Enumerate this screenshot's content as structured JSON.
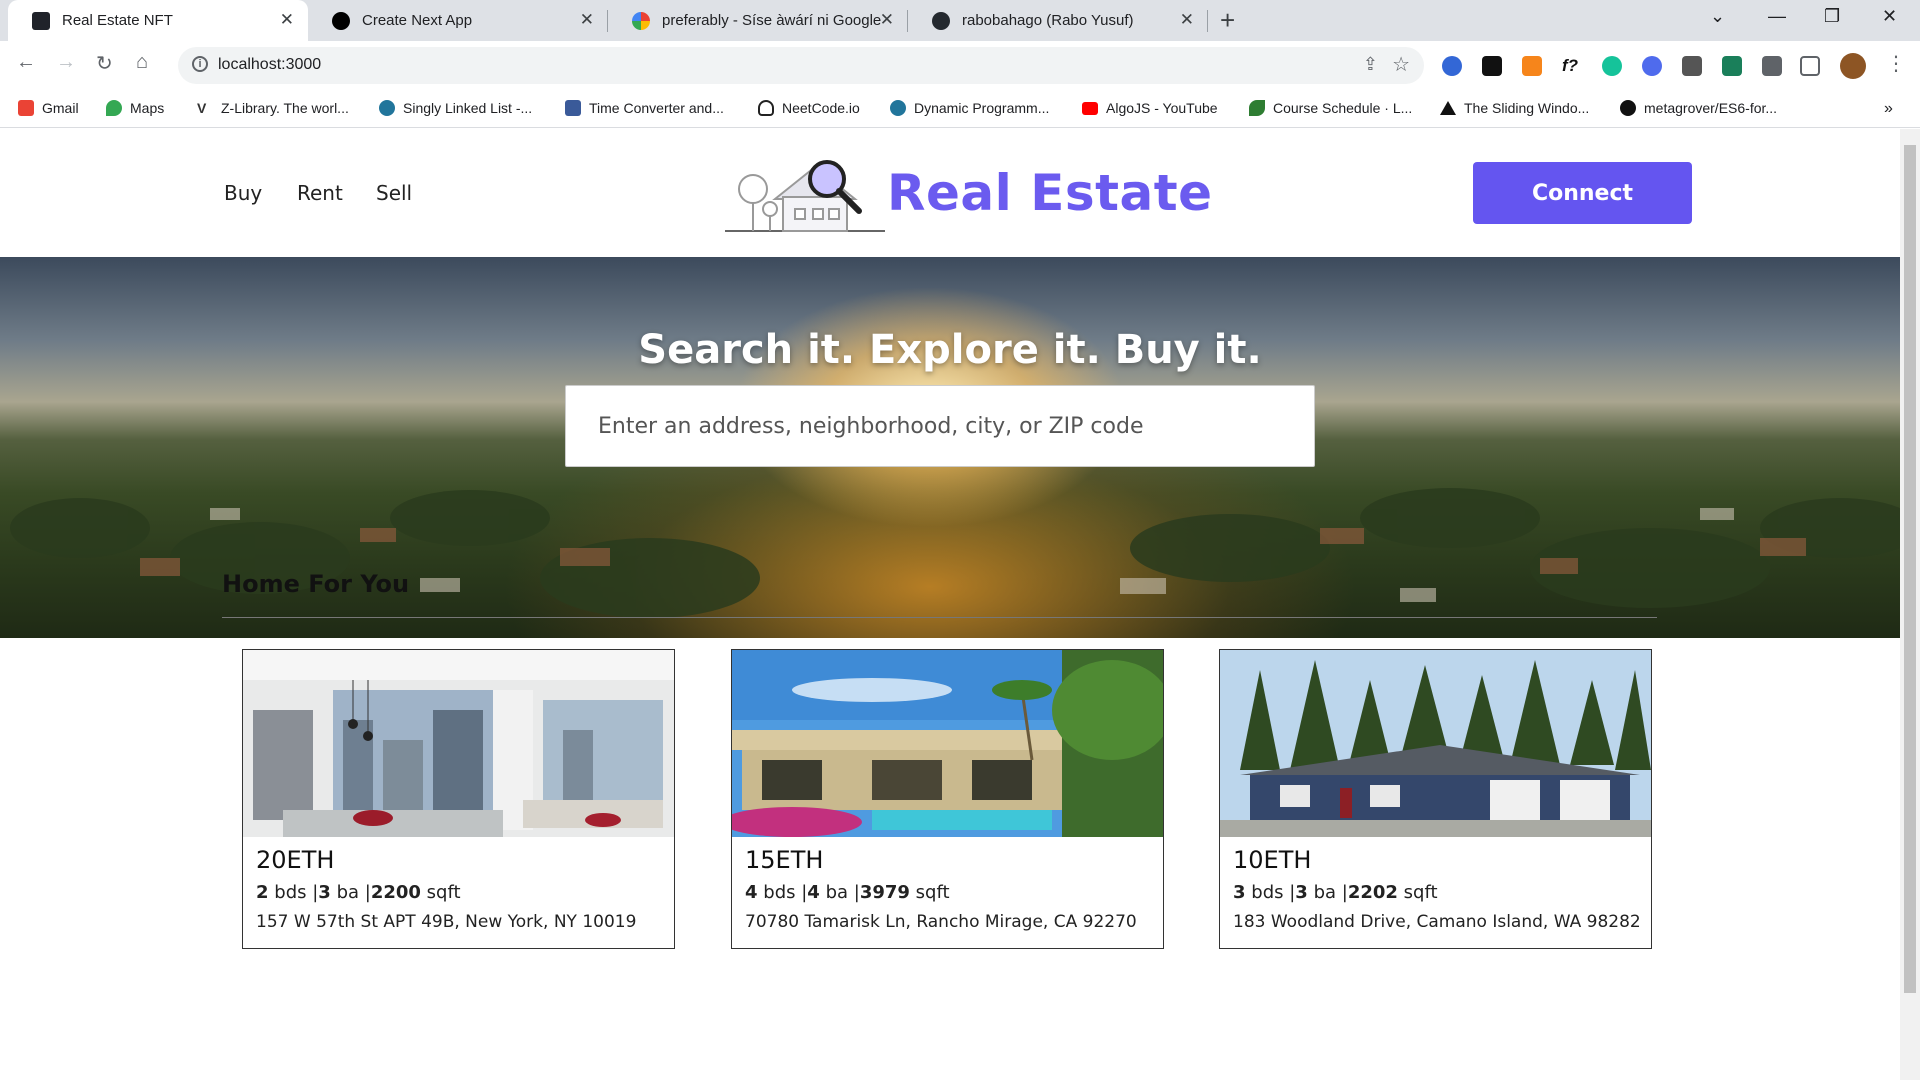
{
  "browser": {
    "tabs": [
      {
        "title": "Real Estate NFT",
        "icon": "react-icon",
        "active": true
      },
      {
        "title": "Create Next App",
        "icon": "nextjs-icon",
        "active": false
      },
      {
        "title": "preferably - Síse àwárí ni Google",
        "icon": "google-icon",
        "active": false
      },
      {
        "title": "rabobahago (Rabo Yusuf)",
        "icon": "github-icon",
        "active": false
      }
    ],
    "url": "localhost:3000",
    "bookmarks": [
      {
        "label": "Gmail",
        "icon": "gmail-icon",
        "color": "#ea4335"
      },
      {
        "label": "Maps",
        "icon": "maps-icon",
        "color": "#34a853"
      },
      {
        "label": "Z-Library. The worl...",
        "icon": "zlibrary-icon",
        "color": "#333333"
      },
      {
        "label": "Singly Linked List -...",
        "icon": "wordpress-icon",
        "color": "#21759b"
      },
      {
        "label": "Time Converter and...",
        "icon": "time-converter-icon",
        "color": "#3a5a99"
      },
      {
        "label": "NeetCode.io",
        "icon": "neetcode-icon",
        "color": "#222222"
      },
      {
        "label": "Dynamic Programm...",
        "icon": "wordpress-icon",
        "color": "#21759b"
      },
      {
        "label": "AlgoJS - YouTube",
        "icon": "youtube-icon",
        "color": "#ff0000"
      },
      {
        "label": "Course Schedule · L...",
        "icon": "leaf-icon",
        "color": "#2e7d32"
      },
      {
        "label": "The Sliding Windo...",
        "icon": "triangle-icon",
        "color": "#111111"
      },
      {
        "label": "metagrover/ES6-for...",
        "icon": "github-icon",
        "color": "#111111"
      }
    ]
  },
  "nav": {
    "links": [
      "Buy",
      "Rent",
      "Sell"
    ],
    "brand": "Real Estate",
    "connect_label": "Connect"
  },
  "hero": {
    "title": "Search it. Explore it. Buy it.",
    "search_placeholder": "Enter an address, neighborhood, city, or ZIP code"
  },
  "section": {
    "title": "Home For You"
  },
  "homes": [
    {
      "price": "20ETH",
      "beds": "2",
      "baths": "3",
      "sqft": "2200",
      "address": "157 W 57th St APT 49B, New York, NY 10019"
    },
    {
      "price": "15ETH",
      "beds": "4",
      "baths": "4",
      "sqft": "3979",
      "address": "70780 Tamarisk Ln, Rancho Mirage, CA 92270"
    },
    {
      "price": "10ETH",
      "beds": "3",
      "baths": "3",
      "sqft": "2202",
      "address": "183 Woodland Drive, Camano Island, WA 98282"
    }
  ],
  "labels": {
    "beds_unit": "bds",
    "baths_unit": "ba",
    "sqft_unit": "sqft"
  },
  "colors": {
    "brand": "#6455f0",
    "brand_text": "#6b5bef"
  }
}
